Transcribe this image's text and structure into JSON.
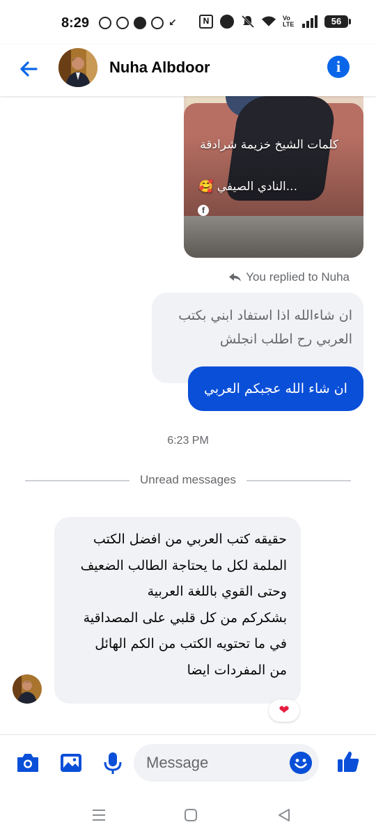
{
  "status_bar": {
    "time": "8:29",
    "network_label": "Vo\nLTE",
    "battery": "56"
  },
  "header": {
    "contact_name": "Nuha Albdoor"
  },
  "video_card": {
    "title": "كلمات الشيخ خزيمة شرادقة",
    "subtitle": "...النادي الصيفي 🥰",
    "source_icon": "f"
  },
  "messages": {
    "replied_label": "You replied to Nuha",
    "quoted_text": "ان شاءالله اذا استفاد ابني بكتب العربي رح اطلب انجلش",
    "outgoing_text": "ان شاء الله عجبكم العربي",
    "timestamp": "6:23 PM",
    "unread_label": "Unread messages",
    "incoming_lines": [
      "حقيقه كتب العربي من افضل الكتب",
      "الملمة لكل ما يحتاجة الطالب الضعيف",
      "وحتى القوي باللغة العربية",
      "بشكركم من كل قلبي على المصداقية",
      "في ما تحتويه الكتب من الكم الهائل",
      "من المفردات ايضا"
    ],
    "reaction": "❤"
  },
  "composer": {
    "placeholder": "Message"
  },
  "icons": {
    "back": "arrow-left-icon",
    "info": "info-icon",
    "camera": "camera-icon",
    "gallery": "image-icon",
    "mic": "microphone-icon",
    "emoji": "smiley-icon",
    "like": "thumbs-up-icon"
  },
  "colors": {
    "accent": "#0a4fd8",
    "info_blue": "#0a66e8",
    "bubble_gray": "#f0f2f5",
    "secondary_text": "#65676b"
  }
}
